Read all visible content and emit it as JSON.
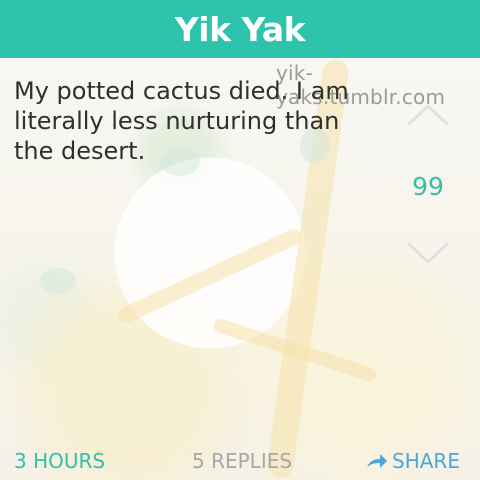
{
  "header": {
    "title": "Yik Yak",
    "color": "#2ec3ac"
  },
  "watermark": "yik-yaks.tumblr.com",
  "yak": {
    "text": "My potted cactus died. I am literally less nurturing than the desert.",
    "votes": "99"
  },
  "icons": {
    "upvote": "chevron-up-icon",
    "downvote": "chevron-down-icon",
    "share": "share-arrow-icon"
  },
  "footer": {
    "time": "3 HOURS",
    "replies": "5 REPLIES",
    "share": "SHARE"
  },
  "colors": {
    "accent": "#35bfa9",
    "share": "#4aa6dd",
    "muted": "#a7a7a7",
    "text": "#2f2f2f"
  }
}
